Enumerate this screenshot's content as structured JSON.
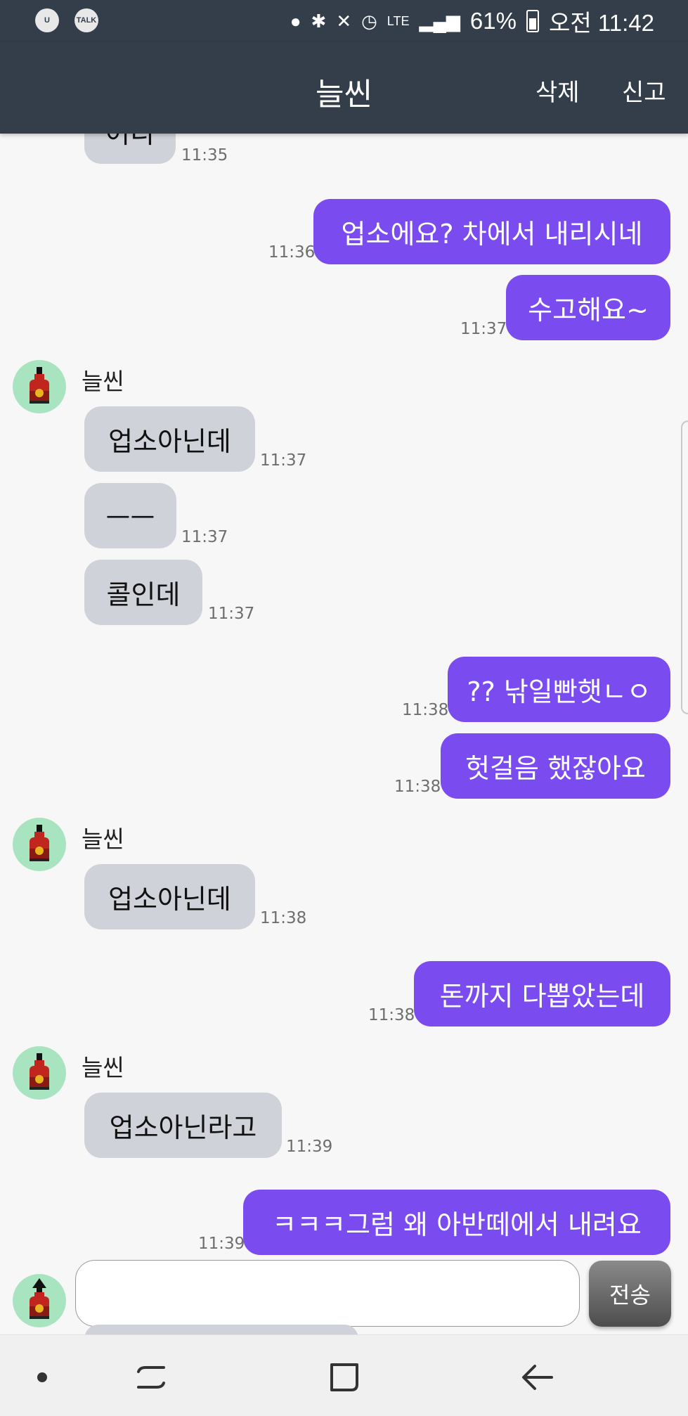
{
  "status_bar": {
    "left_icons": [
      "u-plus-icon",
      "kakaotalk-icon"
    ],
    "talk_label": "TALK",
    "network": "LTE",
    "battery": "61%",
    "clock": "오전 11:42"
  },
  "app_bar": {
    "title": "늘씬",
    "delete_label": "삭제",
    "report_label": "신고"
  },
  "messages": {
    "m0": {
      "text": "어디",
      "time": "11:35"
    },
    "m1": {
      "text": "업소에요? 차에서 내리시네",
      "time": "11:36"
    },
    "m2": {
      "text": "수고해요~",
      "time": "11:37"
    },
    "s1": "늘씬",
    "m3": {
      "text": "업소아닌데",
      "time": "11:37"
    },
    "m4": {
      "text": "ㅡㅡ",
      "time": "11:37"
    },
    "m5": {
      "text": "콜인데",
      "time": "11:37"
    },
    "m6": {
      "text": "?? 낚일빤햇ㄴㅇ",
      "time": "11:38"
    },
    "m7": {
      "text": "헛걸음 했잖아요",
      "time": "11:38"
    },
    "s2": "늘씬",
    "m8": {
      "text": "업소아닌데",
      "time": "11:38"
    },
    "m9": {
      "text": "돈까지 다뽑았는데",
      "time": "11:38"
    },
    "s3": "늘씬",
    "m10": {
      "text": "업소아닌라고",
      "time": "11:39"
    },
    "m11": {
      "text": "ㅋㅋㅋ그럼 왜 아반떼에서 내려요",
      "time": "11:39"
    }
  },
  "composer": {
    "input_value": "",
    "send_label": "전송"
  },
  "colors": {
    "app_bar": "#343e4b",
    "outgoing_bubble": "#7a4cf0",
    "incoming_bubble": "#cfd2d8",
    "avatar_bg": "#a9e4c0"
  }
}
